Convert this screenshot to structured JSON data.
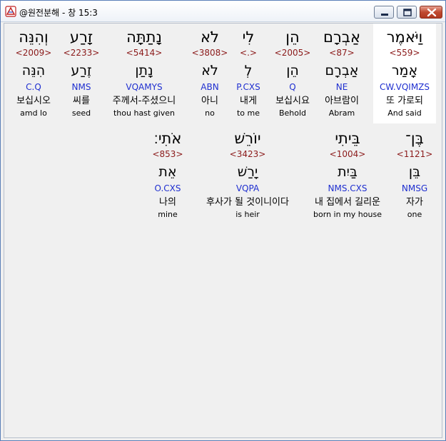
{
  "window": {
    "title": "@원전분해 - 창 15:3"
  },
  "row1": [
    {
      "hebrew": "וַיֹּאמֶר",
      "strong": "<559>",
      "root": "אָמַר",
      "parse": "CW.VQIMZS",
      "korean": "또 가로되",
      "english": "And said",
      "selected": true
    },
    {
      "hebrew": "אַבְרָם",
      "strong": "<87>",
      "root": "אַבְרָם",
      "parse": "NE",
      "korean": "아브람이",
      "english": "Abram",
      "selected": false
    },
    {
      "hebrew": "הֵן",
      "strong": "<2005>",
      "root": "הֵן",
      "parse": "Q",
      "korean": "보십시요",
      "english": "Behold",
      "selected": false
    },
    {
      "hebrew": "לִי",
      "strong": "<.>",
      "root": "לְ",
      "parse": "P.CXS",
      "korean": "내게",
      "english": "to me",
      "selected": false
    },
    {
      "hebrew": "לֹא",
      "strong": "<3808>",
      "root": "לֹא",
      "parse": "ABN",
      "korean": "아니",
      "english": "no",
      "selected": false
    },
    {
      "hebrew": "נָתַתָּה",
      "strong": "<5414>",
      "root": "נָתַן",
      "parse": "VQAMYS",
      "korean": "주께서-주셨으니",
      "english": "thou hast given",
      "selected": false
    },
    {
      "hebrew": "זָרַע",
      "strong": "<2233>",
      "root": "זֶרַע",
      "parse": "NMS",
      "korean": "씨를",
      "english": "seed",
      "selected": false
    },
    {
      "hebrew": "וְהִנֵּה",
      "strong": "<2009>",
      "root": "הִנֵּה",
      "parse": "C.Q",
      "korean": "보십시오",
      "english": "amd lo",
      "selected": false
    }
  ],
  "row2": [
    {
      "hebrew": "בֶּן־",
      "strong": "<1121>",
      "root": "בֵּן",
      "parse": "NMSG",
      "korean": "자가",
      "english": "one",
      "selected": false
    },
    {
      "hebrew": "בֵּיתִי",
      "strong": "<1004>",
      "root": "בַּיִת",
      "parse": "NMS.CXS",
      "korean": "내 집에서 길리운",
      "english": "born in my house",
      "selected": false
    },
    {
      "hebrew": "יוֹרֵשׁ",
      "strong": "<3423>",
      "root": "יָרַשׁ",
      "parse": "VQPA",
      "korean": "후사가 될 것이니이다",
      "english": "is heir",
      "selected": false
    },
    {
      "hebrew": "אֹתִי׃",
      "strong": "<853>",
      "root": "אֵת",
      "parse": "O.CXS",
      "korean": "나의",
      "english": "mine",
      "selected": false
    }
  ]
}
